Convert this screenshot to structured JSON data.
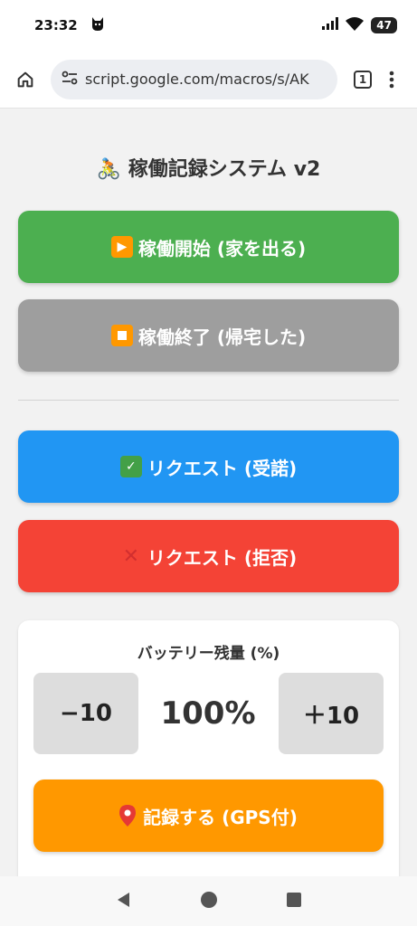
{
  "status_bar": {
    "time": "23:32",
    "battery": "47"
  },
  "browser": {
    "url": "script.google.com/macros/s/AK",
    "tab_count": "1"
  },
  "page": {
    "title_emoji": "🚴",
    "title": "稼働記録システム v2",
    "buttons": {
      "start": "稼働開始 (家を出る)",
      "end": "稼働終了 (帰宅した)",
      "accept": "リクエスト (受諾)",
      "reject": "リクエスト (拒否)"
    },
    "battery_card": {
      "label": "バッテリー残量 (%)",
      "minus": "−10",
      "value": "100%",
      "plus": "＋10",
      "record": "記録する (GPS付)"
    }
  },
  "colors": {
    "start": "#4caf50",
    "end": "#9e9e9e",
    "accept": "#2196f3",
    "reject": "#f44336",
    "record": "#ff9800"
  },
  "icons": {
    "home": "home-icon",
    "site_settings": "tune-icon",
    "menu": "more-vert-icon",
    "play": "play-icon",
    "stop": "stop-icon",
    "check": "check-icon",
    "cross": "cross-icon",
    "pin": "pin-icon"
  }
}
